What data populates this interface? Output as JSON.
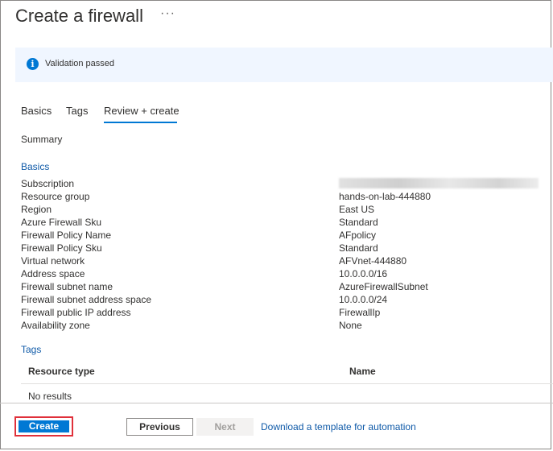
{
  "header": {
    "title": "Create a firewall",
    "more": "···"
  },
  "banner": {
    "icon": "info-icon",
    "text": "Validation passed",
    "accent": "#0078d4",
    "background": "#f0f6ff"
  },
  "tabs": [
    {
      "label": "Basics",
      "active": false
    },
    {
      "label": "Tags",
      "active": false
    },
    {
      "label": "Review + create",
      "active": true
    }
  ],
  "summary_heading": "Summary",
  "basics": {
    "heading": "Basics",
    "rows": [
      {
        "label": "Subscription",
        "value": ""
      },
      {
        "label": "Resource group",
        "value": "hands-on-lab-444880"
      },
      {
        "label": "Region",
        "value": "East US"
      },
      {
        "label": "Azure Firewall Sku",
        "value": "Standard"
      },
      {
        "label": "Firewall Policy Name",
        "value": "AFpolicy"
      },
      {
        "label": "Firewall Policy Sku",
        "value": "Standard"
      },
      {
        "label": "Virtual network",
        "value": "AFVnet-444880"
      },
      {
        "label": "Address space",
        "value": "10.0.0.0/16"
      },
      {
        "label": "Firewall subnet name",
        "value": "AzureFirewallSubnet"
      },
      {
        "label": "Firewall subnet address space",
        "value": "10.0.0.0/24"
      },
      {
        "label": "Firewall public IP address",
        "value": "FirewallIp"
      },
      {
        "label": "Availability zone",
        "value": "None"
      }
    ]
  },
  "tags": {
    "heading": "Tags",
    "columns": [
      "Resource type",
      "Name"
    ],
    "empty": "No results"
  },
  "footer": {
    "create": "Create",
    "previous": "Previous",
    "next": "Next",
    "download_link": "Download a template for automation"
  }
}
